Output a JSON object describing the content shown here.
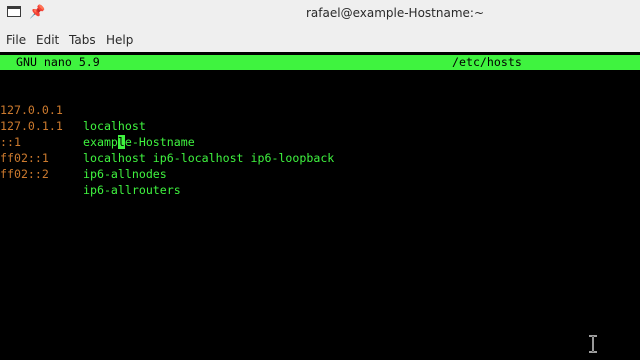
{
  "window": {
    "title": "rafael@example-Hostname:~"
  },
  "menu": {
    "items": [
      {
        "label": "File"
      },
      {
        "label": "Edit"
      },
      {
        "label": "Tabs"
      },
      {
        "label": "Help"
      }
    ]
  },
  "nano": {
    "version": "GNU nano 5.9",
    "filename": "/etc/hosts"
  },
  "hosts": [
    {
      "address": "127.0.0.1",
      "names": "localhost"
    },
    {
      "address": "127.0.1.1",
      "names_before_cursor": "examp",
      "cursor_char": "l",
      "names_after_cursor": "e-Hostname"
    },
    {
      "address": "::1",
      "names": "localhost ip6-localhost ip6-loopback"
    },
    {
      "address": "ff02::1",
      "names": "ip6-allnodes"
    },
    {
      "address": "ff02::2",
      "names": "ip6-allrouters"
    }
  ],
  "colors": {
    "header_bg": "#3ff33f",
    "address": "#cc7a2e",
    "hostname": "#3ff33f",
    "terminal_bg": "#000000"
  },
  "icons": {
    "window_icon": "terminal-icon",
    "pin_icon": "pin-icon",
    "pointer": "text-cursor-icon"
  }
}
